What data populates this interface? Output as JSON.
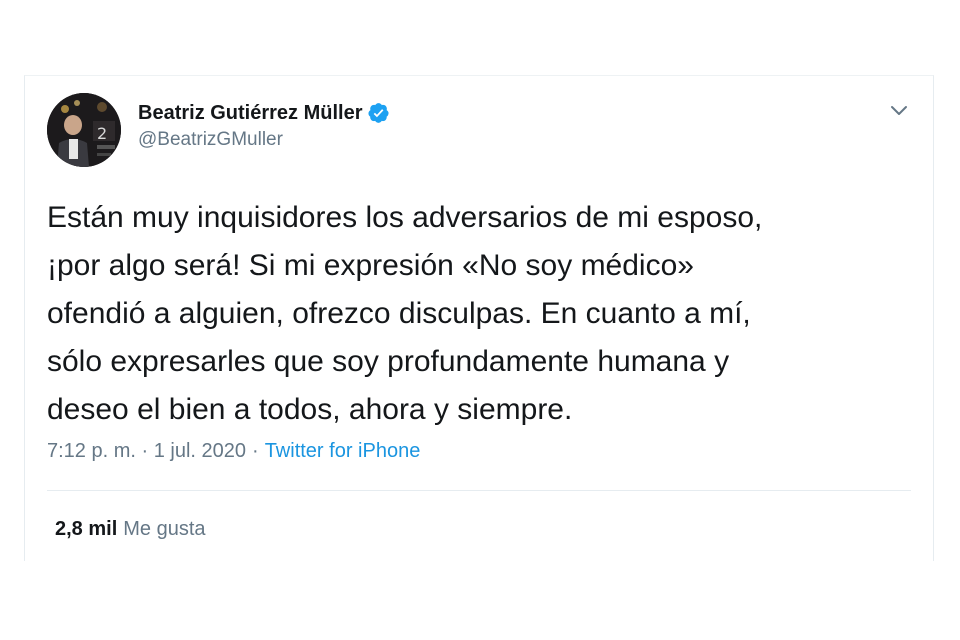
{
  "tweet": {
    "author": {
      "display_name": "Beatriz Gutiérrez Müller",
      "handle": "@BeatrizGMuller",
      "verified": true,
      "avatar_icon": "profile-photo-icon"
    },
    "text": "Están muy inquisidores los adversarios de mi esposo,\n¡por algo será! Si mi expresión «No soy médico»\nofendió a alguien, ofrezco disculpas. En cuanto a mí,\nsólo expresarles que soy profundamente humana y\ndeseo el bien a todos, ahora y siempre.",
    "timestamp": "7:12 p. m. · 1 jul. 2020",
    "separator": "·",
    "source": "Twitter for iPhone",
    "likes_count": "2,8 mil",
    "likes_label": "Me gusta"
  },
  "colors": {
    "text_primary": "#14171a",
    "text_secondary": "#657786",
    "link": "#1b95e0",
    "verified_badge": "#1da1f2",
    "divider": "#e6ecf0"
  }
}
